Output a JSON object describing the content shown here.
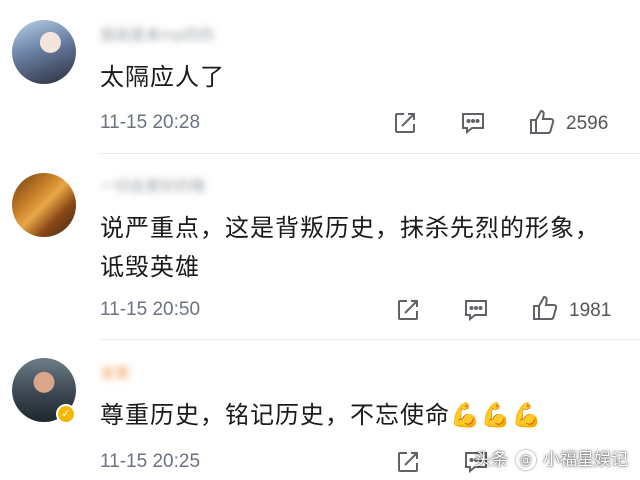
{
  "comments": [
    {
      "username": "我就是来mp的的",
      "text": "太隔应人了",
      "time": "11-15 20:28",
      "likes": "2596"
    },
    {
      "username": "一切会更好的哦",
      "text": "说严重点，这是背叛历史，抹杀先烈的形象，诋毁英雄",
      "time": "11-15 20:50",
      "likes": "1981"
    },
    {
      "username": "全安",
      "text": "尊重历史，铭记历史，不忘使命💪💪💪",
      "time": "11-15 20:25",
      "likes": ""
    }
  ],
  "icons": {
    "share": "share-icon",
    "comment": "comment-icon",
    "like": "thumbs-up-icon",
    "verified": "verified-badge-icon"
  },
  "colors": {
    "badge": "#f5b800",
    "muted_text": "#6b7280",
    "icon_stroke": "#5f6368"
  },
  "watermark": {
    "prefix": "头条",
    "name": "小福星娱记"
  }
}
